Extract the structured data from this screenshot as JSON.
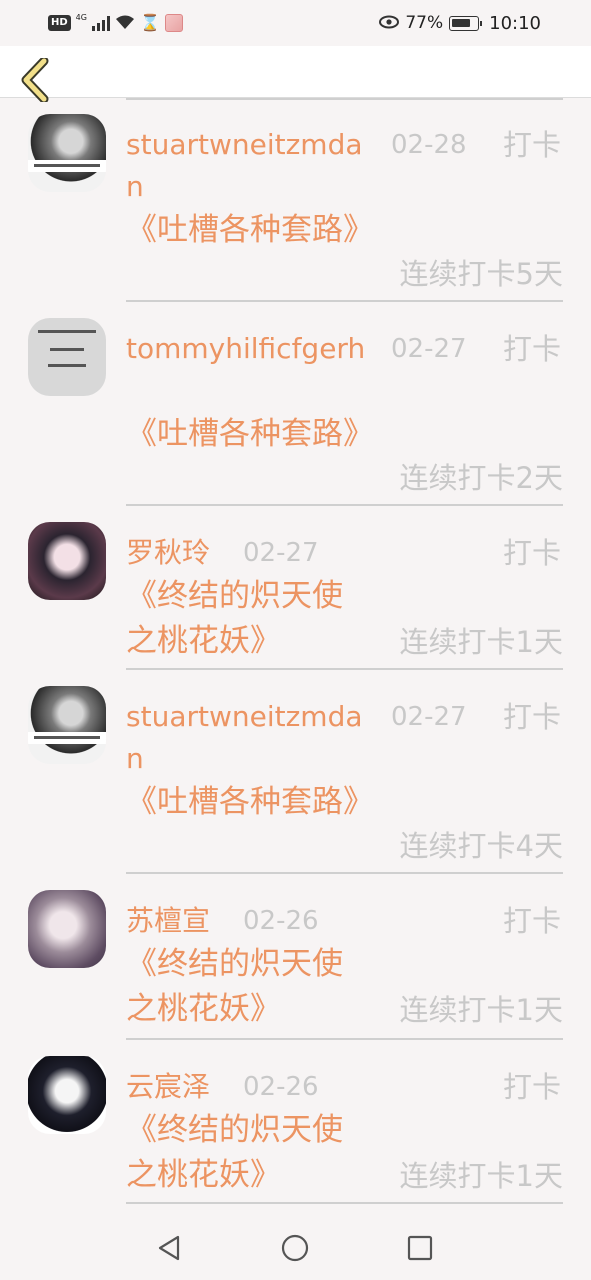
{
  "status_bar": {
    "hd": "HD",
    "network": "4G",
    "battery_percent": "77%",
    "time": "10:10",
    "icons": [
      "hd-icon",
      "signal-icon",
      "wifi-icon",
      "hourglass-icon",
      "app-avatar-icon",
      "eye-icon",
      "battery-icon"
    ]
  },
  "header": {
    "back_icon": "chevron-left-icon"
  },
  "entries": [
    {
      "name": "stuartwneitzmdan",
      "date": "02-28",
      "action": "打卡",
      "book": "《吐槽各种套路》",
      "streak": "连续打卡5天"
    },
    {
      "name": "tommyhilficfgerh",
      "date": "02-27",
      "action": "打卡",
      "book": "《吐槽各种套路》",
      "streak": "连续打卡2天"
    },
    {
      "name": "罗秋玲",
      "date": "02-27",
      "action": "打卡",
      "book": "《终结的炽天使之桃花妖》",
      "streak": "连续打卡1天"
    },
    {
      "name": "stuartwneitzmdan",
      "date": "02-27",
      "action": "打卡",
      "book": "《吐槽各种套路》",
      "streak": "连续打卡4天"
    },
    {
      "name": "苏檀宣",
      "date": "02-26",
      "action": "打卡",
      "book": "《终结的炽天使之桃花妖》",
      "streak": "连续打卡1天"
    },
    {
      "name": "云宸泽",
      "date": "02-26",
      "action": "打卡",
      "book": "《终结的炽天使之桃花妖》",
      "streak": "连续打卡1天"
    }
  ],
  "nav_bar": {
    "icons": [
      "back-triangle-icon",
      "home-circle-icon",
      "recents-square-icon"
    ]
  },
  "colors": {
    "accent": "#ec9462",
    "muted": "#c8c8c8",
    "back_chevron": "#f2e08a"
  }
}
